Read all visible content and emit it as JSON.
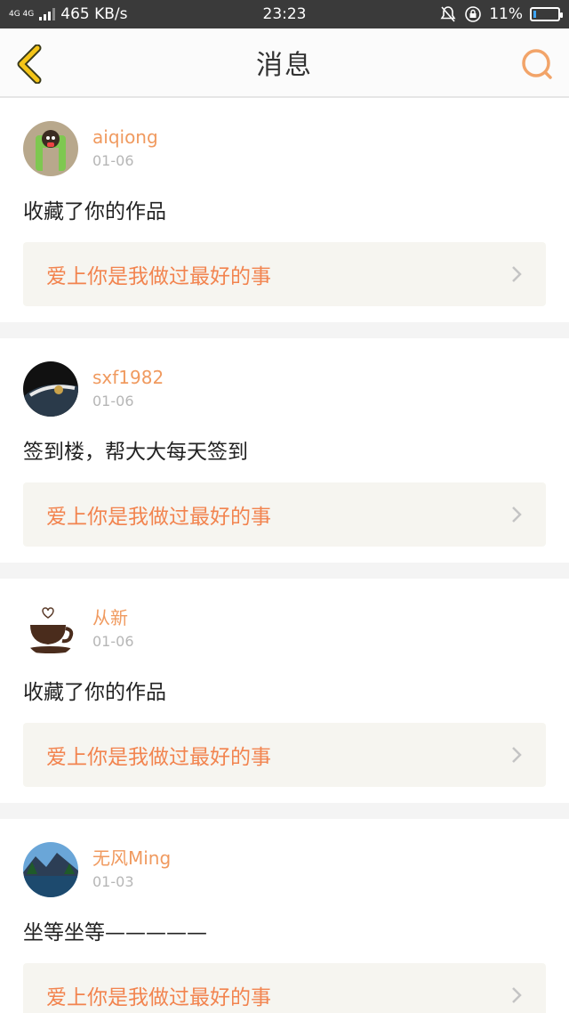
{
  "status_bar": {
    "network": "4G 4G",
    "speed": "465 KB/s",
    "time": "23:23",
    "battery": "11%",
    "battery_level": 0.11
  },
  "header": {
    "title": "消息",
    "back_icon": "chevron-left-icon",
    "search_icon": "search-icon"
  },
  "colors": {
    "accent": "#f2844f",
    "username": "#f09a5f",
    "back_arrow": "#f5c518"
  },
  "messages": [
    {
      "username": "aiqiong",
      "date": "01-06",
      "text": "收藏了你的作品",
      "work_title": "爱上你是我做过最好的事"
    },
    {
      "username": "sxf1982",
      "date": "01-06",
      "text": "签到楼，帮大大每天签到",
      "work_title": "爱上你是我做过最好的事"
    },
    {
      "username": "从新",
      "date": "01-06",
      "text": "收藏了你的作品",
      "work_title": "爱上你是我做过最好的事"
    },
    {
      "username": "无风Ming",
      "date": "01-03",
      "text": "坐等坐等—————",
      "work_title": "爱上你是我做过最好的事"
    }
  ]
}
